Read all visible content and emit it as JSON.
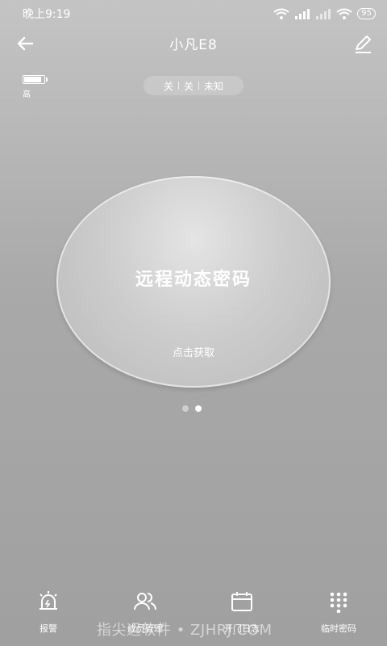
{
  "status_bar": {
    "time": "晚上9:19",
    "battery": "95"
  },
  "header": {
    "title": "小凡E8"
  },
  "device": {
    "battery_label": "高",
    "battery_level": 0.9
  },
  "states": [
    "关",
    "关",
    "未知"
  ],
  "password_panel": {
    "title": "远程动态密码",
    "subtitle": "点击获取"
  },
  "pager": {
    "count": 2,
    "active": 1
  },
  "tabs": [
    {
      "label": "报警",
      "icon": "alarm-icon"
    },
    {
      "label": "成员管理",
      "icon": "members-icon"
    },
    {
      "label": "开门日志",
      "icon": "calendar-icon"
    },
    {
      "label": "临时密码",
      "icon": "keypad-icon"
    }
  ],
  "watermark": "指尖远软件 • ZJHRJ.COM"
}
